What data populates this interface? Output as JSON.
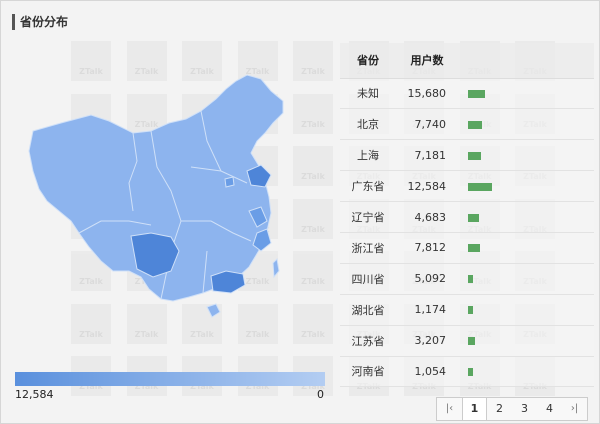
{
  "panel": {
    "title": "省份分布"
  },
  "watermark_text": "ZTalk",
  "legend": {
    "max_label": "12,584",
    "min_label": "0",
    "color_high": "#5a90dd",
    "color_low": "#b3cdf2"
  },
  "table": {
    "headers": [
      "省份",
      "用户数",
      ""
    ],
    "rows": [
      {
        "province": "未知",
        "users": "15,680",
        "share": 0.55
      },
      {
        "province": "北京",
        "users": "7,740",
        "share": 0.46
      },
      {
        "province": "上海",
        "users": "7,181",
        "share": 0.44
      },
      {
        "province": "广东省",
        "users": "12,584",
        "share": 0.8
      },
      {
        "province": "辽宁省",
        "users": "4,683",
        "share": 0.36
      },
      {
        "province": "浙江省",
        "users": "7,812",
        "share": 0.4
      },
      {
        "province": "四川省",
        "users": "5,092",
        "share": 0.18
      },
      {
        "province": "湖北省",
        "users": "1,174",
        "share": 0.16
      },
      {
        "province": "江苏省",
        "users": "3,207",
        "share": 0.22
      },
      {
        "province": "河南省",
        "users": "1,054",
        "share": 0.15
      }
    ],
    "bar_color": "#5aa660"
  },
  "pagination": {
    "first_icon": "first-page-icon",
    "last_icon": "last-page-icon",
    "first_glyph": "|‹",
    "last_glyph": "›|",
    "pages": [
      "1",
      "2",
      "3",
      "4"
    ],
    "current": "1"
  },
  "map": {
    "colors": {
      "base": "#8db4ee",
      "mid": "#6a9de6",
      "dark": "#4e85d8",
      "border": "#cfe0f8"
    }
  }
}
